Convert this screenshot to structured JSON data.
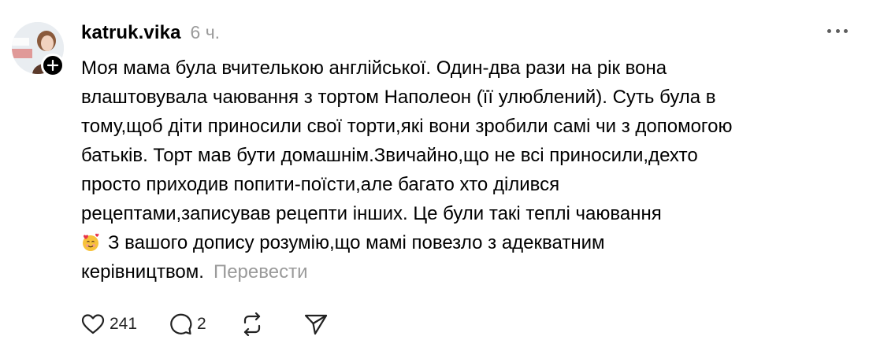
{
  "post": {
    "username": "katruk.vika",
    "time": "6 ч.",
    "lines": [
      "Моя мама була вчителькою англійської. Один-два рази на рік вона",
      "влаштовувала чаювання з тортом Наполеон (її улюблений). Суть була в",
      "тому,щоб діти приносили свої торти,які вони зробили самі чи з допомогою",
      "батьків. Торт мав бути домашнім.Звичайно,що не всі приносили,дехто",
      "просто приходив попити-поїсти,але багато хто ділився",
      "рецептами,записував рецепти інших. Це були такі теплі чаювання"
    ],
    "emoji_line": "З вашого допису розумію,що мамі повезло з адекватним",
    "last_line": "керівництвом.",
    "translate_label": "Перевести",
    "emoji_icon": "smiling-face-with-hearts-icon"
  },
  "actions": {
    "likes": "241",
    "comments": "2",
    "like_icon": "heart-icon",
    "comment_icon": "comment-bubble-icon",
    "repost_icon": "repost-icon",
    "share_icon": "send-icon"
  },
  "colors": {
    "text": "#000000",
    "muted": "#9a9a9a",
    "icon": "#222222"
  }
}
